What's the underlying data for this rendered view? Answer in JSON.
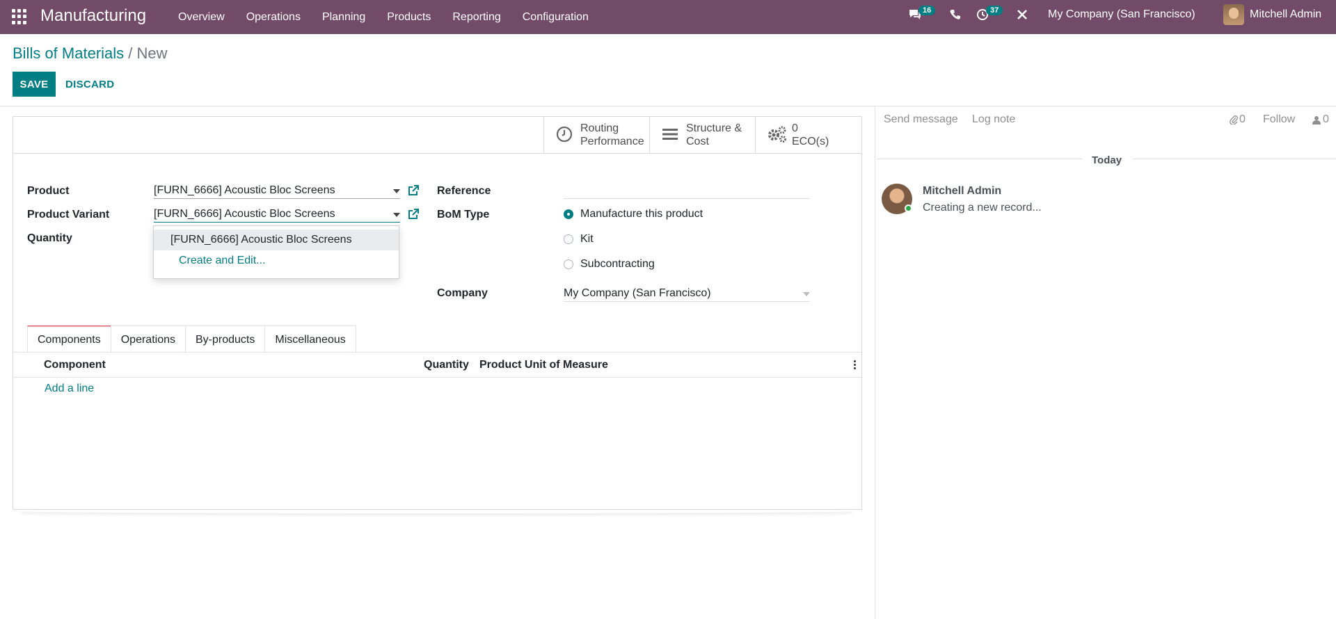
{
  "navbar": {
    "app_title": "Manufacturing",
    "menu": [
      "Overview",
      "Operations",
      "Planning",
      "Products",
      "Reporting",
      "Configuration"
    ],
    "messages_count": "16",
    "activities_count": "37",
    "company": "My Company (San Francisco)",
    "user": "Mitchell Admin"
  },
  "breadcrumb": {
    "parent": "Bills of Materials",
    "separator": "/",
    "current": "New"
  },
  "toolbar": {
    "save_label": "SAVE",
    "discard_label": "DISCARD"
  },
  "smart_buttons": {
    "routing_line1": "Routing",
    "routing_line2": "Performance",
    "structure_line1": "Structure &",
    "structure_line2": "Cost",
    "eco_count": "0",
    "eco_label": "ECO(s)"
  },
  "form": {
    "product_label": "Product",
    "product_value": "[FURN_6666] Acoustic Bloc Screens",
    "variant_label": "Product Variant",
    "variant_value": "[FURN_6666] Acoustic Bloc Screens",
    "quantity_label": "Quantity",
    "reference_label": "Reference",
    "reference_value": "",
    "bom_type_label": "BoM Type",
    "bom_type_options": [
      "Manufacture this product",
      "Kit",
      "Subcontracting"
    ],
    "bom_type_selected": "Manufacture this product",
    "company_label": "Company",
    "company_value": "My Company (San Francisco)"
  },
  "autocomplete": {
    "items": [
      "[FURN_6666] Acoustic Bloc Screens"
    ],
    "create_label": "Create and Edit..."
  },
  "tabs": [
    "Components",
    "Operations",
    "By-products",
    "Miscellaneous"
  ],
  "active_tab": "Components",
  "components_table": {
    "columns": [
      "Component",
      "Quantity",
      "Product Unit of Measure"
    ],
    "rows": [],
    "add_line_label": "Add a line"
  },
  "chatter": {
    "send_message": "Send message",
    "log_note": "Log note",
    "attachments_count": "0",
    "follow_label": "Follow",
    "followers_count": "0",
    "date_separator": "Today",
    "messages": [
      {
        "author": "Mitchell Admin",
        "body": "Creating a new record..."
      }
    ]
  },
  "colors": {
    "brand": "#714B67",
    "accent": "#017E84"
  }
}
